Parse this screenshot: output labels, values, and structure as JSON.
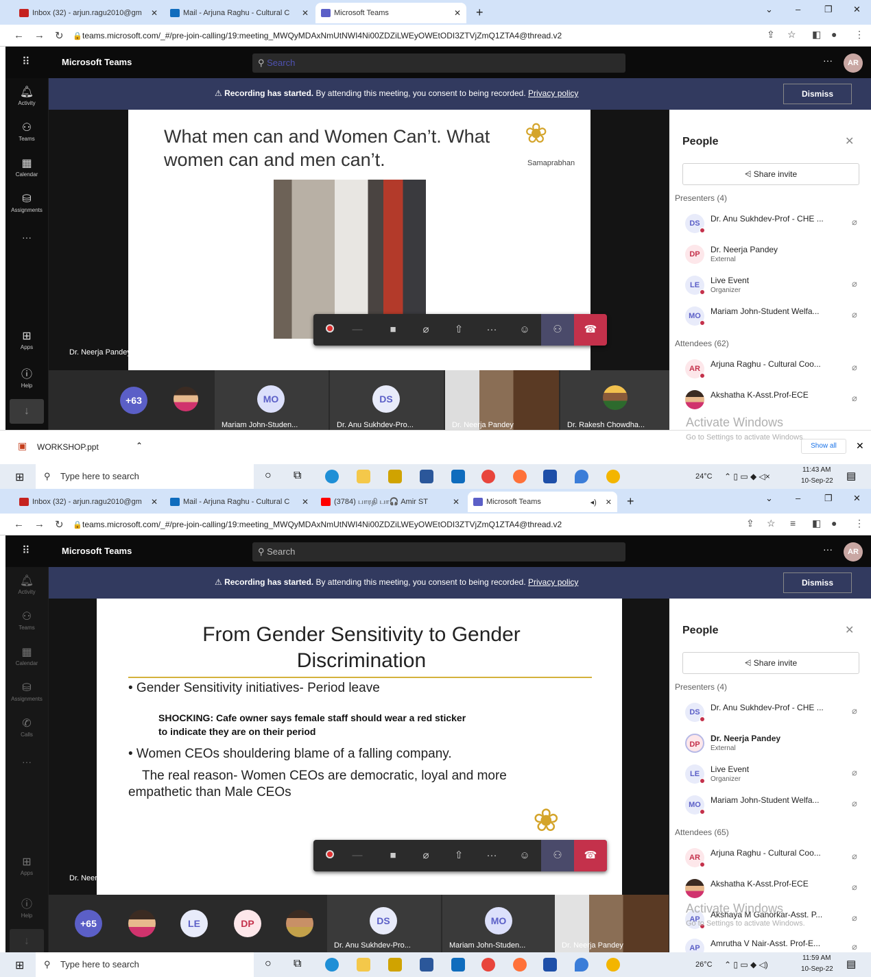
{
  "screens": [
    {
      "tabs": [
        {
          "label": "Inbox (32) - arjun.ragu2010@gm",
          "color": "#c5221f"
        },
        {
          "label": "Mail - Arjuna Raghu - Cultural C",
          "color": "#0f6cbd"
        },
        {
          "label": "Microsoft Teams",
          "color": "#5b5fc7"
        }
      ],
      "new_tab": "+",
      "url": "teams.microsoft.com/_#/pre-join-calling/19:meeting_MWQyMDAxNmUtNWI4Ni00ZDZiLWEyOWEtODI3ZTVjZmQ1ZTA4@thread.v2",
      "search_placeholder": "Search",
      "slide": {
        "title": "What men can and Women Can’t. What women can and men can’t.",
        "logo_caption": "Samaprabhan"
      },
      "stage_name": "Dr. Neerja Pandey",
      "strip": {
        "overflow": "+63",
        "tiles": [
          {
            "initials": "MO",
            "name": "Mariam John-Studen..."
          },
          {
            "initials": "DS",
            "name": "Dr. Anu Sukhdev-Pro..."
          },
          {
            "initials": "",
            "name": "Dr. Neerja Pandey"
          },
          {
            "initials": "",
            "name": "Dr. Rakesh Chowdha..."
          }
        ]
      },
      "presenters_header": "Presenters (4)",
      "attendees_header": "Attendees (62)",
      "presenters": [
        {
          "initials": "DS",
          "name": "Dr. Anu Sukhdev-Prof - CHE ...",
          "sub": ""
        },
        {
          "initials": "DP",
          "name": "Dr. Neerja Pandey",
          "sub": "External"
        },
        {
          "initials": "LE",
          "name": "Live Event",
          "sub": "Organizer"
        },
        {
          "initials": "MO",
          "name": "Mariam John-Student Welfa...",
          "sub": ""
        }
      ],
      "attendees": [
        {
          "initials": "AR",
          "name": "Arjuna Raghu - Cultural Coo..."
        },
        {
          "initials": "",
          "name": "Akshatha K-Asst.Prof-ECE"
        }
      ],
      "watermark": {
        "title": "Activate Windows",
        "sub": "Go to Settings to activate Windows."
      },
      "download": {
        "file": "WORKSHOP.ppt",
        "show_all": "Show all"
      },
      "taskbar": {
        "search": "Type here to search",
        "temp": "24°C",
        "time": "11:43 AM",
        "date": "10-Sep-22"
      }
    },
    {
      "tabs": [
        {
          "label": "Inbox (32) - arjun.ragu2010@gm",
          "color": "#c5221f"
        },
        {
          "label": "Mail - Arjuna Raghu - Cultural C",
          "color": "#0f6cbd"
        },
        {
          "label": "(3784) பாரதி பா🎧 Amir ST",
          "color": "#ff0000"
        },
        {
          "label": "Microsoft Teams",
          "color": "#5b5fc7"
        }
      ],
      "new_tab": "+",
      "url": "teams.microsoft.com/_#/pre-join-calling/19:meeting_MWQyMDAxNmUtNWI4Ni00ZDZiLWEyOWEtODI3ZTVjZmQ1ZTA4@thread.v2",
      "search_placeholder": "Search",
      "slide": {
        "title": "From Gender Sensitivity to Gender Discrimination",
        "bullet1": "• Gender Sensitivity initiatives- Period leave",
        "shock1": "SHOCKING: Cafe owner says female staff should wear a red sticker",
        "shock2": "to indicate they are on their period",
        "bullet2": "• Women CEOs shouldering blame of a falling company.",
        "para1": "The real reason- Women CEOs are democratic, loyal and more",
        "para2": "empathetic than Male CEOs"
      },
      "stage_name": "Dr. Neerja Pandey",
      "strip": {
        "overflow": "+65",
        "circles": [
          "",
          "LE",
          "DP",
          ""
        ],
        "tiles": [
          {
            "initials": "DS",
            "name": "Dr. Anu Sukhdev-Pro..."
          },
          {
            "initials": "MO",
            "name": "Mariam John-Studen..."
          },
          {
            "initials": "",
            "name": "Dr. Neerja Pandey"
          }
        ]
      },
      "presenters_header": "Presenters (4)",
      "attendees_header": "Attendees (65)",
      "presenters": [
        {
          "initials": "DS",
          "name": "Dr. Anu Sukhdev-Prof - CHE ...",
          "sub": ""
        },
        {
          "initials": "DP",
          "name": "Dr. Neerja Pandey",
          "sub": "External"
        },
        {
          "initials": "LE",
          "name": "Live Event",
          "sub": "Organizer"
        },
        {
          "initials": "MO",
          "name": "Mariam John-Student Welfa...",
          "sub": ""
        }
      ],
      "attendees": [
        {
          "initials": "AR",
          "name": "Arjuna Raghu - Cultural Coo..."
        },
        {
          "initials": "",
          "name": "Akshatha K-Asst.Prof-ECE"
        },
        {
          "initials": "AP",
          "name": "Akshaya M Ganorkar-Asst. P..."
        },
        {
          "initials": "AP",
          "name": "Amrutha V Nair-Asst. Prof-E..."
        }
      ],
      "watermark": {
        "title": "Activate Windows",
        "sub": "Go to Settings to activate Windows."
      },
      "taskbar": {
        "search": "Type here to search",
        "temp": "26°C",
        "time": "11:59 AM",
        "date": "10-Sep-22"
      }
    }
  ],
  "common": {
    "app_title": "Microsoft Teams",
    "avatar": "AR",
    "banner_bold": "Recording has started.",
    "banner_text": "By attending this meeting, you consent to being recorded.",
    "banner_link": "Privacy policy",
    "dismiss": "Dismiss",
    "people_title": "People",
    "share_invite": "Share invite",
    "rail": [
      "Activity",
      "Teams",
      "Calendar",
      "Assignments",
      "Apps",
      "Help"
    ],
    "rail2": [
      "Activity",
      "Teams",
      "Calendar",
      "Assignments",
      "Calls",
      "Apps",
      "Help"
    ],
    "colors": {
      "banner": "#323a5f",
      "hangup": "#c4314b",
      "teams_purple": "#5b5fc7"
    }
  }
}
